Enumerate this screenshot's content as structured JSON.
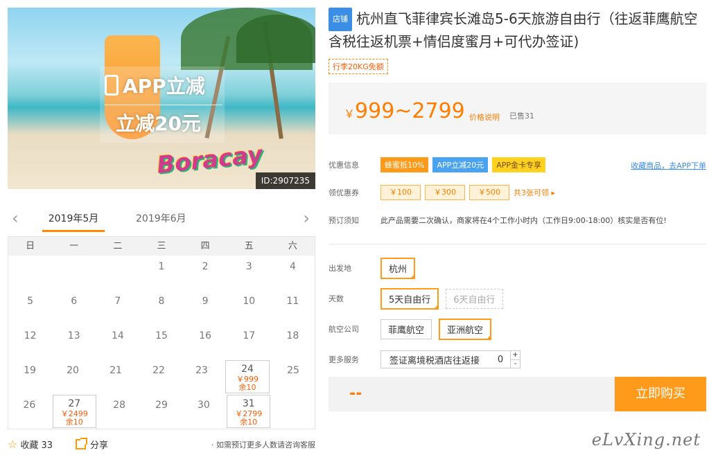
{
  "hero": {
    "promo_line1": "APP立减",
    "promo_line2": "立减20元",
    "logo_text": "Boracay",
    "image_id": "ID:2907235"
  },
  "calendar": {
    "prev_icon": "chevron-left-icon",
    "next_icon": "chevron-right-icon",
    "tabs": [
      "2019年5月",
      "2019年6月"
    ],
    "weekdays": [
      "日",
      "一",
      "二",
      "三",
      "四",
      "五",
      "六"
    ],
    "rows": [
      [
        {
          "d": ""
        },
        {
          "d": ""
        },
        {
          "d": ""
        },
        {
          "d": "1"
        },
        {
          "d": "2"
        },
        {
          "d": "3"
        },
        {
          "d": "4"
        }
      ],
      [
        {
          "d": "5"
        },
        {
          "d": "6"
        },
        {
          "d": "7"
        },
        {
          "d": "8"
        },
        {
          "d": "9"
        },
        {
          "d": "10"
        },
        {
          "d": "11"
        }
      ],
      [
        {
          "d": "12"
        },
        {
          "d": "13"
        },
        {
          "d": "14"
        },
        {
          "d": "15"
        },
        {
          "d": "16"
        },
        {
          "d": "17"
        },
        {
          "d": "18"
        }
      ],
      [
        {
          "d": "19"
        },
        {
          "d": "20"
        },
        {
          "d": "21"
        },
        {
          "d": "22"
        },
        {
          "d": "23"
        },
        {
          "d": "24",
          "price": "￥999",
          "stock": "余10"
        },
        {
          "d": "25"
        }
      ],
      [
        {
          "d": "26"
        },
        {
          "d": "27",
          "price": "￥2499",
          "stock": "余10"
        },
        {
          "d": "28"
        },
        {
          "d": "29"
        },
        {
          "d": "30"
        },
        {
          "d": "31",
          "price": "￥2799",
          "stock": "余10"
        },
        {
          "d": ""
        }
      ]
    ]
  },
  "footer_left": {
    "fav_label": "收藏 33",
    "share_label": "分享",
    "consult": "· 如需预订更多人数请咨询客服"
  },
  "product": {
    "shop_tag": "店铺",
    "title": "杭州直飞菲律宾长滩岛5-6天旅游自由行（往返菲鹰航空含税往返机票+情侣度蜜月+可代办签证)",
    "luggage": "行李20KG免额",
    "price_symbol": "￥",
    "price": "999~2799",
    "price_note": "价格说明",
    "sold": "已售31"
  },
  "info": {
    "discount_label": "优惠信息",
    "discount_tags": [
      "蜂蜜抵10%",
      "APP立减20元",
      "APP金卡专享"
    ],
    "fav_link": "收藏商品，去APP下单",
    "coupon_label": "领优惠券",
    "coupons": [
      "￥100",
      "￥300",
      "￥500"
    ],
    "coupon_more": "共3张可领 ▸",
    "notice_label": "预订须知",
    "notice": "此产品需要二次确认，商家将在4个工作小时内（工作日9:00-18:00）核实是否有位!"
  },
  "options": {
    "departure_label": "出发地",
    "departure": "杭州",
    "days_label": "天数",
    "days_selected": "5天自由行",
    "days_disabled": "6天自由行",
    "airline_label": "航空公司",
    "airline_1": "菲鹰航空",
    "airline_2": "亚洲航空",
    "service_label": "更多服务",
    "service_name": "签证离境税酒店往返接",
    "service_qty": "0",
    "plus": "+",
    "minus": "-"
  },
  "buy": {
    "total": "--",
    "button": "立即购买"
  },
  "watermark": "eLvXing.net"
}
